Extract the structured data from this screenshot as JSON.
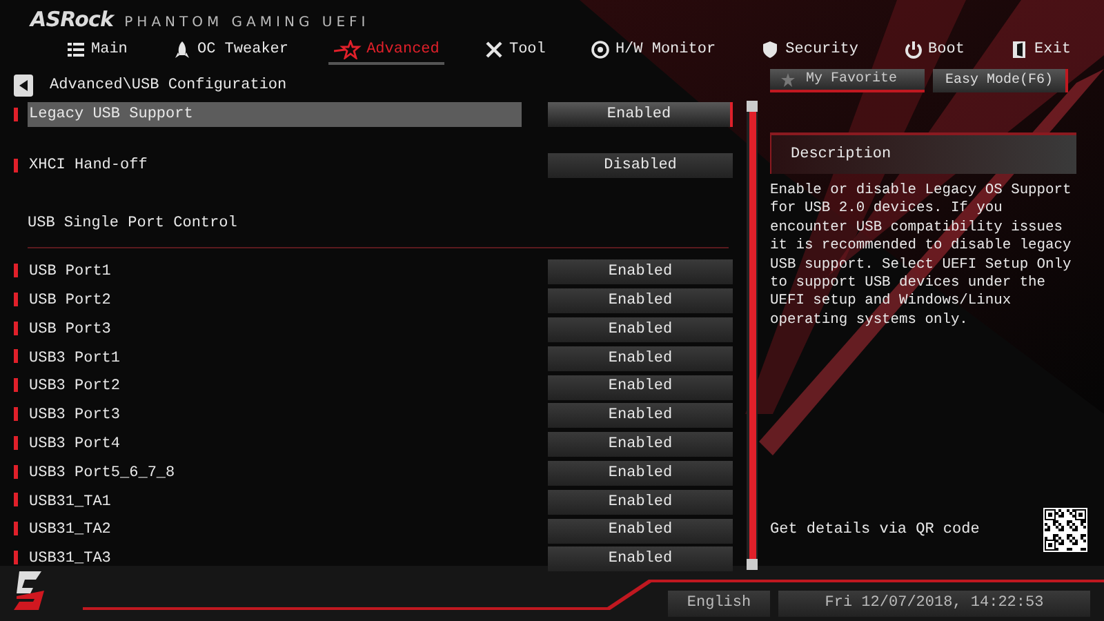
{
  "brand": {
    "logo": "ASRock",
    "product": "PHANTOM GAMING UEFI"
  },
  "tabs": [
    {
      "label": "Main",
      "selected": false
    },
    {
      "label": "OC Tweaker",
      "selected": false
    },
    {
      "label": "Advanced",
      "selected": true
    },
    {
      "label": "Tool",
      "selected": false
    },
    {
      "label": "H/W Monitor",
      "selected": false
    },
    {
      "label": "Security",
      "selected": false
    },
    {
      "label": "Boot",
      "selected": false
    },
    {
      "label": "Exit",
      "selected": false
    }
  ],
  "breadcrumb": "Advanced\\USB Configuration",
  "favorite_button": "My Favorite",
  "easy_mode_button": "Easy Mode(F6)",
  "items": [
    {
      "kind": "setting",
      "label": "Legacy USB Support",
      "value": "Enabled",
      "selected": true
    },
    {
      "kind": "setting",
      "label": "XHCI Hand-off",
      "value": "Disabled",
      "selected": false
    },
    {
      "kind": "heading",
      "label": "USB Single Port Control"
    },
    {
      "kind": "setting",
      "label": "USB Port1",
      "value": "Enabled",
      "selected": false
    },
    {
      "kind": "setting",
      "label": "USB Port2",
      "value": "Enabled",
      "selected": false
    },
    {
      "kind": "setting",
      "label": "USB Port3",
      "value": "Enabled",
      "selected": false
    },
    {
      "kind": "setting",
      "label": "USB3 Port1",
      "value": "Enabled",
      "selected": false
    },
    {
      "kind": "setting",
      "label": "USB3 Port2",
      "value": "Enabled",
      "selected": false
    },
    {
      "kind": "setting",
      "label": "USB3 Port3",
      "value": "Enabled",
      "selected": false
    },
    {
      "kind": "setting",
      "label": "USB3 Port4",
      "value": "Enabled",
      "selected": false
    },
    {
      "kind": "setting",
      "label": "USB3 Port5_6_7_8",
      "value": "Enabled",
      "selected": false
    },
    {
      "kind": "setting",
      "label": "USB31_TA1",
      "value": "Enabled",
      "selected": false
    },
    {
      "kind": "setting",
      "label": "USB31_TA2",
      "value": "Enabled",
      "selected": false
    },
    {
      "kind": "setting",
      "label": "USB31_TA3",
      "value": "Enabled",
      "selected": false
    }
  ],
  "description": {
    "title": "Description",
    "text": "Enable or disable Legacy OS Support for USB 2.0 devices. If you encounter USB compatibility issues it is recommended to disable legacy USB support. Select UEFI Setup Only to support USB devices under the UEFI setup and Windows/Linux operating systems only."
  },
  "qr_hint": "Get details via QR code",
  "status_bar": {
    "language": "English",
    "datetime": "Fri 12/07/2018, 14:22:53"
  }
}
